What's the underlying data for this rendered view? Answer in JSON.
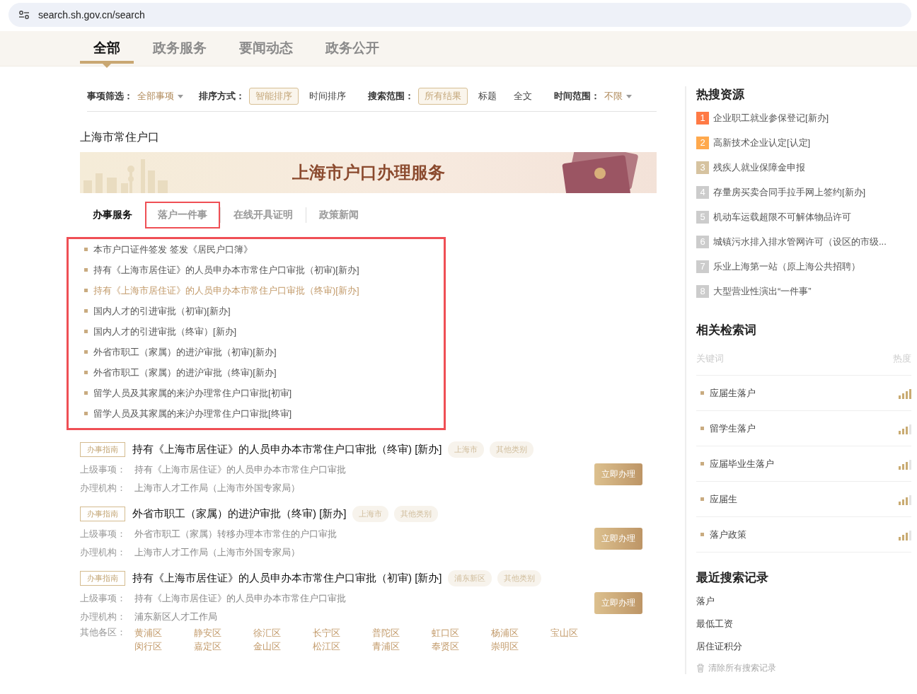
{
  "address_bar": {
    "url": "search.sh.gov.cn/search"
  },
  "nav_tabs": [
    {
      "label": "全部",
      "selected": true
    },
    {
      "label": "政务服务",
      "selected": false
    },
    {
      "label": "要闻动态",
      "selected": false
    },
    {
      "label": "政务公开",
      "selected": false
    }
  ],
  "filters": [
    {
      "label": "事项筛选：",
      "kind": "dropdown",
      "options": [
        {
          "label": "全部事项",
          "selected": true
        }
      ]
    },
    {
      "label": "排序方式：",
      "kind": "choices",
      "options": [
        {
          "label": "智能排序",
          "selected": true
        },
        {
          "label": "时间排序",
          "selected": false
        }
      ]
    },
    {
      "label": "搜索范围：",
      "kind": "choices",
      "options": [
        {
          "label": "所有结果",
          "selected": true
        },
        {
          "label": "标题",
          "selected": false
        },
        {
          "label": "全文",
          "selected": false
        }
      ]
    },
    {
      "label": "时间范围：",
      "kind": "dropdown",
      "options": [
        {
          "label": "不限",
          "selected": true
        }
      ]
    }
  ],
  "query_title": "上海市常住户口",
  "banner": {
    "title": "上海市户口办理服务"
  },
  "service_tabs": [
    {
      "label": "办事服务",
      "selected": true,
      "highlighted": false
    },
    {
      "label": "落户一件事",
      "selected": false,
      "highlighted": true
    },
    {
      "label": "在线开具证明",
      "selected": false,
      "highlighted": false
    },
    {
      "label": "政策新闻",
      "selected": false,
      "highlighted": false
    }
  ],
  "service_list": {
    "highlighted": true,
    "items": [
      {
        "label": "本市户口证件签发 签发《居民户口簿》",
        "selected": false
      },
      {
        "label": "持有《上海市居住证》的人员申办本市常住户口审批（初审)[新办]",
        "selected": false
      },
      {
        "label": "持有《上海市居住证》的人员申办本市常住户口审批（终审)[新办]",
        "selected": true
      },
      {
        "label": "国内人才的引进审批（初审)[新办]",
        "selected": false
      },
      {
        "label": "国内人才的引进审批（终审）[新办]",
        "selected": false
      },
      {
        "label": "外省市职工（家属）的进沪审批（初审)[新办]",
        "selected": false
      },
      {
        "label": "外省市职工（家属）的进沪审批（终审)[新办]",
        "selected": false
      },
      {
        "label": "留学人员及其家属的来沪办理常住户口审批[初审]",
        "selected": false
      },
      {
        "label": "留学人员及其家属的来沪办理常住户口审批[终审]",
        "selected": false
      }
    ]
  },
  "results": [
    {
      "badge": "办事指南",
      "title": "持有《上海市居住证》的人员申办本市常住户口审批（终审) [新办]",
      "tags": [
        "上海市",
        "其他类别"
      ],
      "button": "立即办理",
      "fields": [
        {
          "label": "上级事项：",
          "value": "持有《上海市居住证》的人员申办本市常住户口审批"
        },
        {
          "label": "办理机构：",
          "value": "上海市人才工作局（上海市外国专家局）"
        }
      ]
    },
    {
      "badge": "办事指南",
      "title": "外省市职工（家属）的进沪审批（终审) [新办]",
      "tags": [
        "上海市",
        "其他类别"
      ],
      "button": "立即办理",
      "fields": [
        {
          "label": "上级事项：",
          "value": "外省市职工（家属）转移办理本市常住的户口审批"
        },
        {
          "label": "办理机构：",
          "value": "上海市人才工作局（上海市外国专家局）"
        }
      ]
    },
    {
      "badge": "办事指南",
      "title": "持有《上海市居住证》的人员申办本市常住户口审批（初审) [新办]",
      "tags": [
        "浦东新区",
        "其他类别"
      ],
      "button": "立即办理",
      "fields": [
        {
          "label": "上级事项：",
          "value": "持有《上海市居住证》的人员申办本市常住户口审批"
        },
        {
          "label": "办理机构：",
          "value": "浦东新区人才工作局"
        }
      ],
      "districts": {
        "label": "其他各区：",
        "items": [
          "黄浦区",
          "静安区",
          "徐汇区",
          "长宁区",
          "普陀区",
          "虹口区",
          "杨浦区",
          "宝山区",
          "闵行区",
          "嘉定区",
          "金山区",
          "松江区",
          "青浦区",
          "奉贤区",
          "崇明区"
        ]
      }
    }
  ],
  "hot_resources": {
    "title": "热搜资源",
    "items": [
      {
        "rank": "1",
        "label": "企业职工就业参保登记[新办]",
        "color": "#ff7a45"
      },
      {
        "rank": "2",
        "label": "高新技术企业认定[认定]",
        "color": "#ffa94d"
      },
      {
        "rank": "3",
        "label": "残疾人就业保障金申报",
        "color": "#d6c3a0"
      },
      {
        "rank": "4",
        "label": "存量房买卖合同手拉手网上签约[新办]",
        "color": "#cccccc"
      },
      {
        "rank": "5",
        "label": "机动车运载超限不可解体物品许可",
        "color": "#cccccc"
      },
      {
        "rank": "6",
        "label": "城镇污水排入排水管网许可（设区的市级...",
        "color": "#cccccc"
      },
      {
        "rank": "7",
        "label": "乐业上海第一站（原上海公共招聘）",
        "color": "#cccccc"
      },
      {
        "rank": "8",
        "label": "大型营业性演出“一件事”",
        "color": "#cccccc"
      }
    ]
  },
  "related": {
    "title": "相关检索词",
    "columns": [
      "关键词",
      "热度"
    ],
    "items": [
      {
        "label": "应届生落户",
        "level": 1
      },
      {
        "label": "留学生落户",
        "level": 0.75
      },
      {
        "label": "应届毕业生落户",
        "level": 0.75
      },
      {
        "label": "应届生",
        "level": 0.75
      },
      {
        "label": "落户政策",
        "level": 0.75
      }
    ]
  },
  "recent": {
    "title": "最近搜索记录",
    "items": [
      "落户",
      "最低工资",
      "居住证积分"
    ],
    "clear": "清除所有搜索记录"
  }
}
